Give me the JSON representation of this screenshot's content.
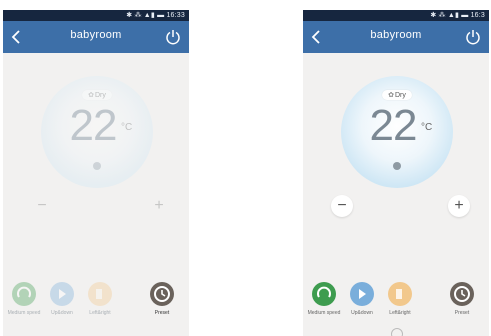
{
  "status_time_left": "16:33",
  "status_time_right": "16:3",
  "nav": {
    "title": "babyroom"
  },
  "dial": {
    "mode_label": "Dry",
    "temperature": "22",
    "unit": "°C"
  },
  "buttons": {
    "minus": "−",
    "plus": "+"
  },
  "functions": [
    {
      "label": "Medium speed",
      "icon": "fan-icon",
      "color": "#3e9c4f"
    },
    {
      "label": "Up&down",
      "icon": "swing-updown-icon",
      "color": "#7aaedb"
    },
    {
      "label": "Left&right",
      "icon": "swing-leftright-icon",
      "color": "#f2c88c"
    },
    {
      "label": "Preset",
      "icon": "clock-icon",
      "color": "#6a625b"
    }
  ],
  "theme": {
    "nav": "#3d6fa8",
    "status": "#16263f",
    "background": "#f2f1f0"
  }
}
